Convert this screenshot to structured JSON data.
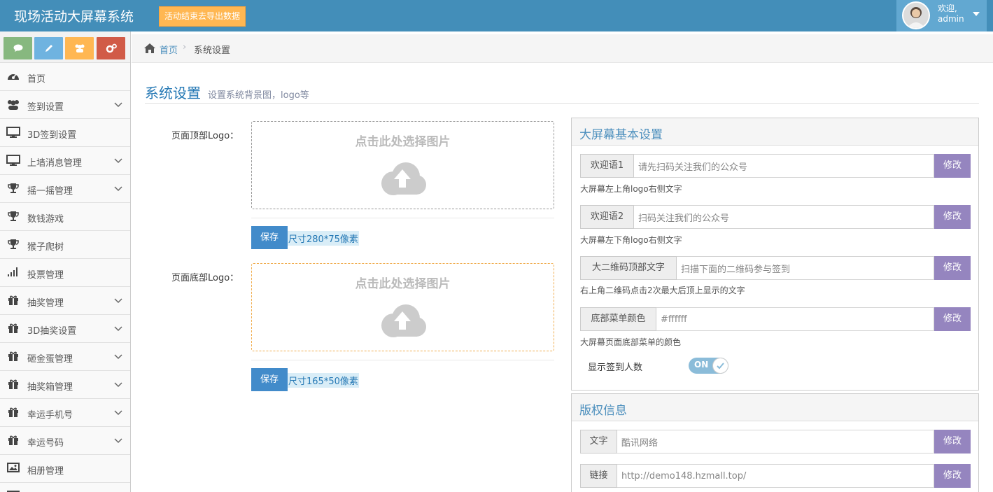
{
  "navbar": {
    "brand": "现场活动大屏幕系统",
    "export_button": "活动结束去导出数据",
    "user_welcome": "欢迎,",
    "user_name": "admin"
  },
  "shortcuts": [
    {
      "icon": "chat-icon",
      "color": "#87b87f"
    },
    {
      "icon": "pencil-icon",
      "color": "#6fb3e0"
    },
    {
      "icon": "users-icon",
      "color": "#ffb752"
    },
    {
      "icon": "cogs-icon",
      "color": "#d15b47"
    }
  ],
  "sidebar": {
    "items": [
      {
        "label": "首页",
        "icon": "dashboard-icon",
        "submenu": false
      },
      {
        "label": "签到设置",
        "icon": "users-icon",
        "submenu": true
      },
      {
        "label": "3D签到设置",
        "icon": "desktop-icon",
        "submenu": false
      },
      {
        "label": "上墙消息管理",
        "icon": "desktop-icon",
        "submenu": true
      },
      {
        "label": "摇一摇管理",
        "icon": "trophy-icon",
        "submenu": true
      },
      {
        "label": "数钱游戏",
        "icon": "trophy-icon",
        "submenu": false
      },
      {
        "label": "猴子爬树",
        "icon": "trophy-icon",
        "submenu": false
      },
      {
        "label": "投票管理",
        "icon": "signal-icon",
        "submenu": false
      },
      {
        "label": "抽奖管理",
        "icon": "gift-icon",
        "submenu": true
      },
      {
        "label": "3D抽奖设置",
        "icon": "gift-icon",
        "submenu": true
      },
      {
        "label": "砸金蛋管理",
        "icon": "gift-icon",
        "submenu": true
      },
      {
        "label": "抽奖箱管理",
        "icon": "gift-icon",
        "submenu": true
      },
      {
        "label": "幸运手机号",
        "icon": "gift-icon",
        "submenu": true
      },
      {
        "label": "幸运号码",
        "icon": "gift-icon",
        "submenu": true
      },
      {
        "label": "相册管理",
        "icon": "picture-icon",
        "submenu": false
      },
      {
        "label": "",
        "icon": "picture-icon",
        "submenu": false
      }
    ]
  },
  "breadcrumb": {
    "home": "首页",
    "current": "系统设置"
  },
  "page": {
    "title": "系统设置",
    "subtitle": "设置系统背景图，logo等"
  },
  "logo_form": {
    "top_label": "页面顶部Logo：",
    "bottom_label": "页面底部Logo：",
    "upload_text": "点击此处选择图片",
    "save_label": "保存",
    "top_size": "尺寸280*75像素",
    "bottom_size": "尺寸165*50像素"
  },
  "screen_settings": {
    "title": "大屏幕基本设置",
    "edit_label": "修改",
    "fields": [
      {
        "label": "欢迎语1",
        "value": "请先扫码关注我们的公众号",
        "help": "大屏幕左上角logo右侧文字"
      },
      {
        "label": "欢迎语2",
        "value": "扫码关注我们的公众号",
        "help": "大屏幕左下角logo右侧文字"
      },
      {
        "label": "大二维码顶部文字",
        "value": "扫描下面的二维码参与签到",
        "help": "右上角二维码点击2次最大后顶上显示的文字"
      },
      {
        "label": "底部菜单颜色",
        "value": "#ffffff",
        "help": "大屏幕页面底部菜单的颜色"
      }
    ],
    "toggle_label": "显示签到人数",
    "toggle_state": "ON"
  },
  "copyright": {
    "title": "版权信息",
    "edit_label": "修改",
    "fields": [
      {
        "label": "文字",
        "value": "酷讯网络"
      },
      {
        "label": "链接",
        "value": "http://demo148.hzmall.top/"
      }
    ]
  },
  "colors": {
    "navbar": "#438eb9",
    "export_button": "#ffb752",
    "save_button": "#428bca",
    "edit_button": "#9585bf",
    "link": "#4c8fbd"
  }
}
